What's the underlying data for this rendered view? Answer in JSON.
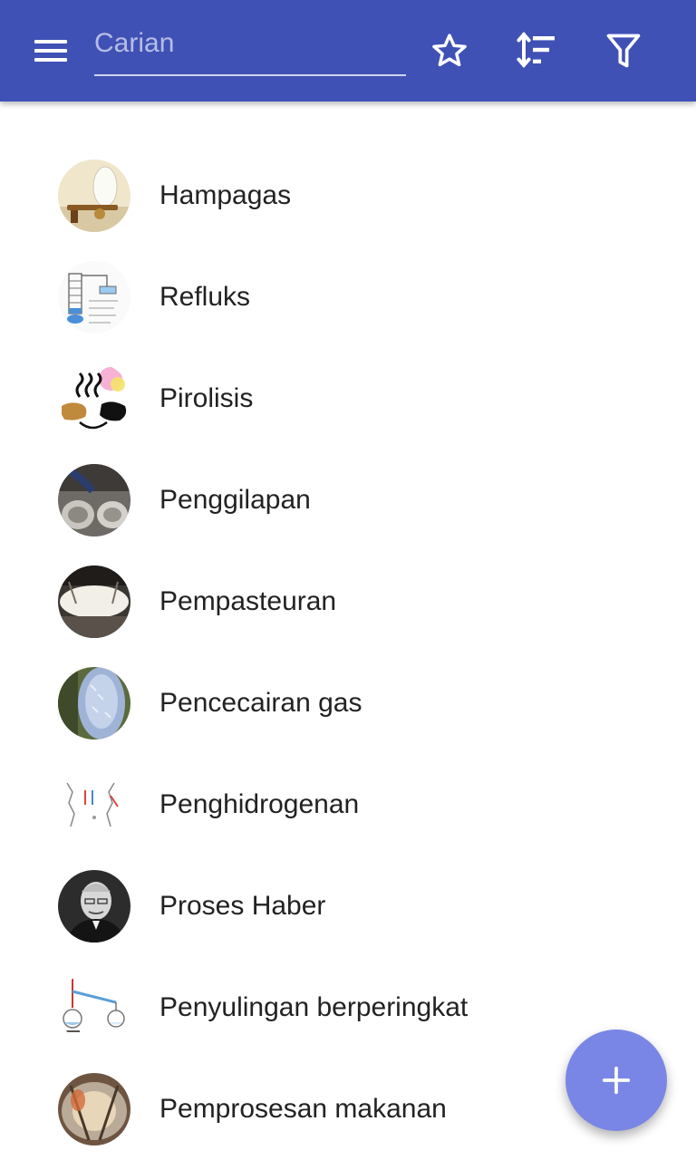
{
  "toolbar": {
    "menu_icon": "menu-icon",
    "search_placeholder": "Carian",
    "search_value": "",
    "favorite_icon": "star-outline-icon",
    "sort_icon": "sort-icon",
    "filter_icon": "filter-icon"
  },
  "list": {
    "items": [
      {
        "label": "Hampagas",
        "icon": "vacuum-pump-photo"
      },
      {
        "label": "Refluks",
        "icon": "reflux-diagram"
      },
      {
        "label": "Pirolisis",
        "icon": "pyrolysis-diagram"
      },
      {
        "label": "Penggilapan",
        "icon": "polishing-photo"
      },
      {
        "label": "Pempasteuran",
        "icon": "pasteurization-photo"
      },
      {
        "label": "Pencecairan gas",
        "icon": "gas-liquefaction-photo"
      },
      {
        "label": "Penghidrogenan",
        "icon": "hydrogenation-diagram"
      },
      {
        "label": "Proses Haber",
        "icon": "portrait-photo"
      },
      {
        "label": "Penyulingan berperingkat",
        "icon": "fractional-distillation-diagram"
      },
      {
        "label": "Pemprosesan makanan",
        "icon": "food-processing-photo"
      }
    ]
  },
  "fab": {
    "icon": "add-icon"
  },
  "colors": {
    "appbar": "#3f51b5",
    "fab": "#7986e6",
    "text": "#222222"
  }
}
